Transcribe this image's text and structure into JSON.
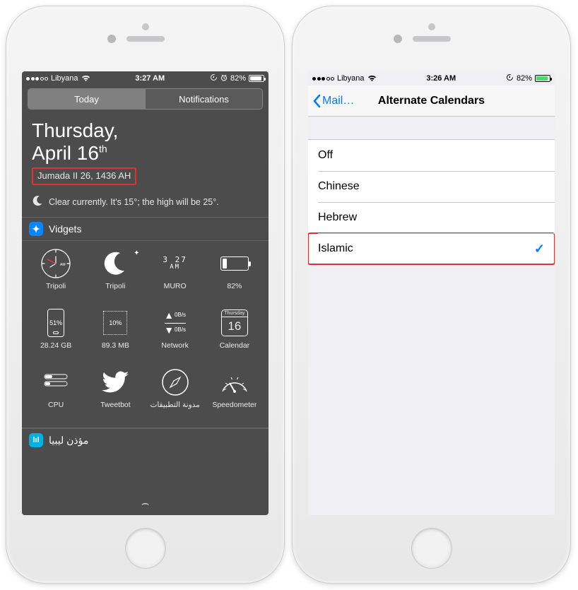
{
  "left": {
    "status": {
      "carrier": "Libyana",
      "time": "3:27 AM",
      "battery_pct": "82%"
    },
    "segmented": {
      "today": "Today",
      "notifications": "Notifications"
    },
    "date": {
      "dayname": "Thursday,",
      "month_day": "April 16",
      "ordinal": "th",
      "alt": "Jumada II 26, 1436 AH"
    },
    "weather_text": "Clear currently. It's 15°; the high will be 25°.",
    "widgets_header": "Vidgets",
    "widgets_row1": [
      {
        "label": "Tripoli",
        "type": "clock",
        "sub": "AM"
      },
      {
        "label": "Tripoli",
        "type": "moon"
      },
      {
        "label": "MURO",
        "type": "digital",
        "time_top": "3 27",
        "time_bot": "AM"
      },
      {
        "label": "82%",
        "type": "battery"
      }
    ],
    "widgets_row2": [
      {
        "label": "28.24 GB",
        "type": "phone",
        "inner": "51%"
      },
      {
        "label": "89.3 MB",
        "type": "chip",
        "inner": "10%"
      },
      {
        "label": "Network",
        "type": "network",
        "up": "0B/s",
        "down": "0B/s"
      },
      {
        "label": "Calendar",
        "type": "calendar",
        "day": "Thursday",
        "num": "16"
      }
    ],
    "widgets_row3": [
      {
        "label": "CPU",
        "type": "cpu"
      },
      {
        "label": "Tweetbot",
        "type": "twitter"
      },
      {
        "label": "مدونة التطبيقات",
        "type": "compass"
      },
      {
        "label": "Speedometer",
        "type": "gauge"
      }
    ],
    "extra_widget": "مؤذن ليبيا"
  },
  "right": {
    "status": {
      "carrier": "Libyana",
      "time": "3:26 AM",
      "battery_pct": "82%"
    },
    "nav": {
      "back": "Mail…",
      "title": "Alternate Calendars"
    },
    "options": [
      {
        "label": "Off",
        "selected": false
      },
      {
        "label": "Chinese",
        "selected": false
      },
      {
        "label": "Hebrew",
        "selected": false
      },
      {
        "label": "Islamic",
        "selected": true
      }
    ]
  }
}
